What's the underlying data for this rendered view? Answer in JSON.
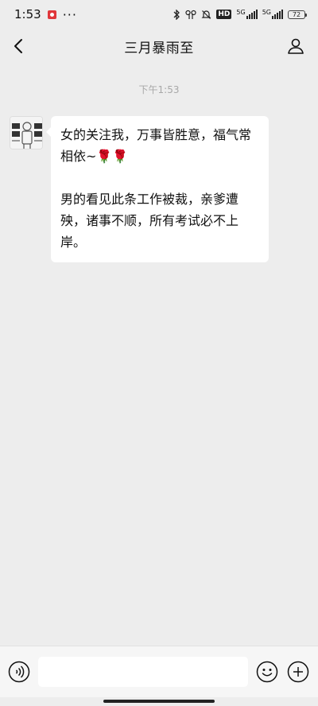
{
  "status_bar": {
    "time": "1:53",
    "more": "···",
    "hd_label": "HD",
    "network_1": "5G",
    "network_2": "5G",
    "battery": "72"
  },
  "nav": {
    "title": "三月暴雨至"
  },
  "chat": {
    "timestamp": "下午1:53",
    "messages": [
      {
        "sender": "other",
        "paragraphs": [
          "女的关注我，万事皆胜意，福气常相依~🌹🌹",
          "男的看见此条工作被裁，亲爹遭殃，诸事不顺，所有考试必不上岸。"
        ]
      }
    ]
  },
  "input_bar": {
    "value": "",
    "placeholder": ""
  },
  "colors": {
    "background": "#ededed",
    "bubble": "#ffffff",
    "timestamp": "#a8a8a8",
    "notif": "#e0363a"
  }
}
